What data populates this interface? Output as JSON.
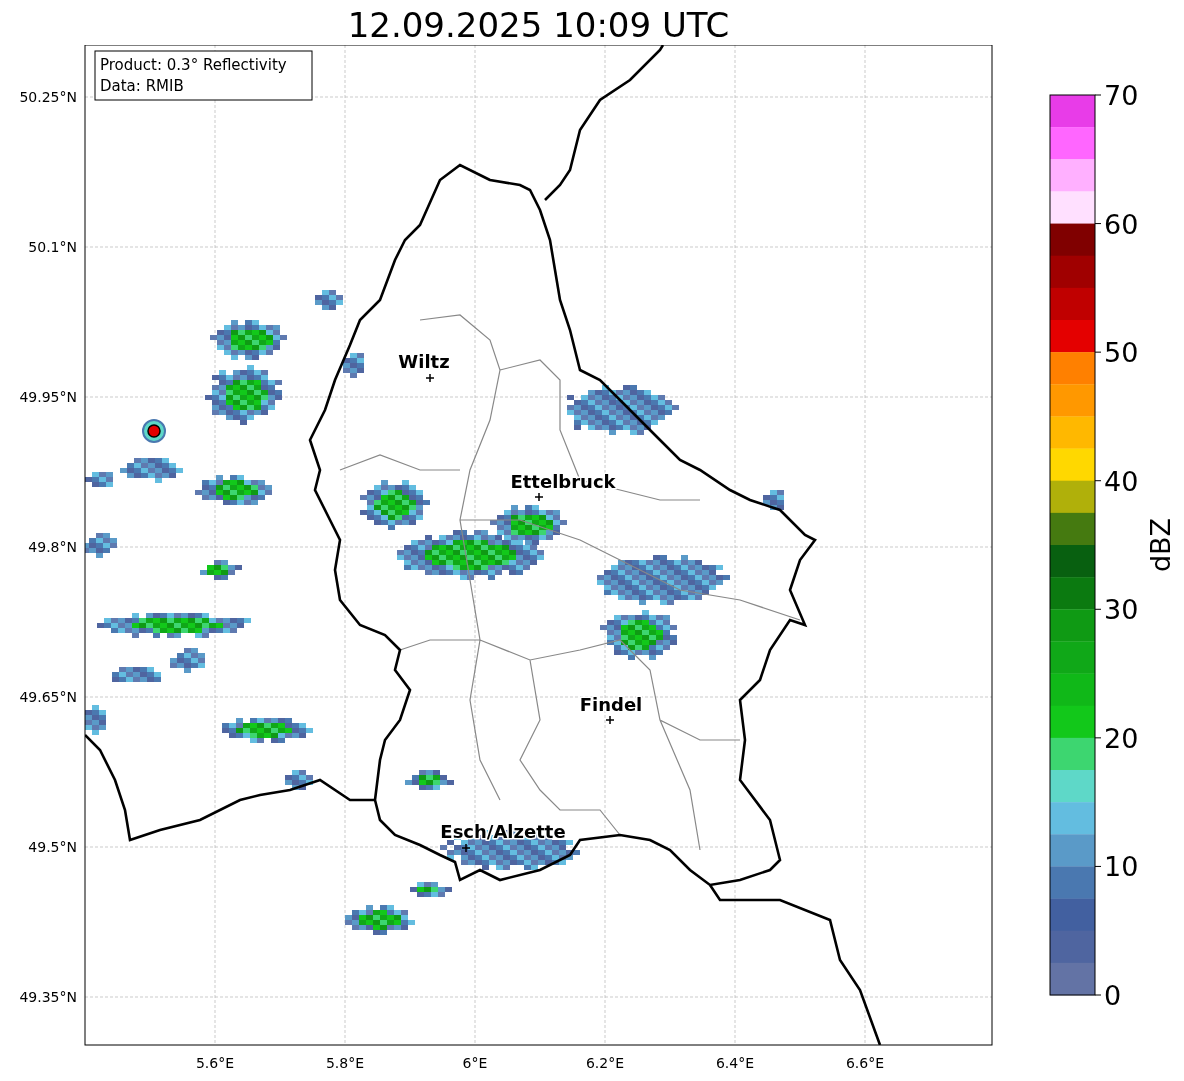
{
  "title": "12.09.2025 10:09 UTC",
  "info_box": [
    "Product: 0.3° Reflectivity",
    "Data: RMIB"
  ],
  "map": {
    "y_ticks": [
      "50.25°N",
      "50.1°N",
      "49.95°N",
      "49.8°N",
      "49.65°N",
      "49.5°N",
      "49.35°N"
    ],
    "x_ticks": [
      "5.6°E",
      "5.8°E",
      "6°E",
      "6.2°E",
      "6.4°E",
      "6.6°E"
    ],
    "cities": [
      {
        "name": "Wiltz"
      },
      {
        "name": "Ettelbruck"
      },
      {
        "name": "Findel"
      },
      {
        "name": "Esch/Alzette"
      }
    ]
  },
  "colorbar": {
    "ticks": [
      "70",
      "60",
      "50",
      "40",
      "30",
      "20",
      "10",
      "0"
    ],
    "label": "dBZ",
    "bins": [
      {
        "color": "#e83ce8"
      },
      {
        "color": "#ff66ff"
      },
      {
        "color": "#ffb0ff"
      },
      {
        "color": "#ffe0ff"
      },
      {
        "color": "#800000"
      },
      {
        "color": "#a00000"
      },
      {
        "color": "#c00000"
      },
      {
        "color": "#e40000"
      },
      {
        "color": "#ff8000"
      },
      {
        "color": "#ff9800"
      },
      {
        "color": "#ffb800"
      },
      {
        "color": "#ffd800"
      },
      {
        "color": "#b0b00a"
      },
      {
        "color": "#457a10"
      },
      {
        "color": "#086010"
      },
      {
        "color": "#0b7a10"
      },
      {
        "color": "#0f9a14"
      },
      {
        "color": "#10a818"
      },
      {
        "color": "#10b818"
      },
      {
        "color": "#12c81a"
      },
      {
        "color": "#3dd670"
      },
      {
        "color": "#5ed8c8"
      },
      {
        "color": "#63bde0"
      },
      {
        "color": "#5a9ac8"
      },
      {
        "color": "#4a78b0"
      },
      {
        "color": "#4260a0"
      },
      {
        "color": "#4f65a0"
      },
      {
        "color": "#6373a5"
      }
    ]
  }
}
